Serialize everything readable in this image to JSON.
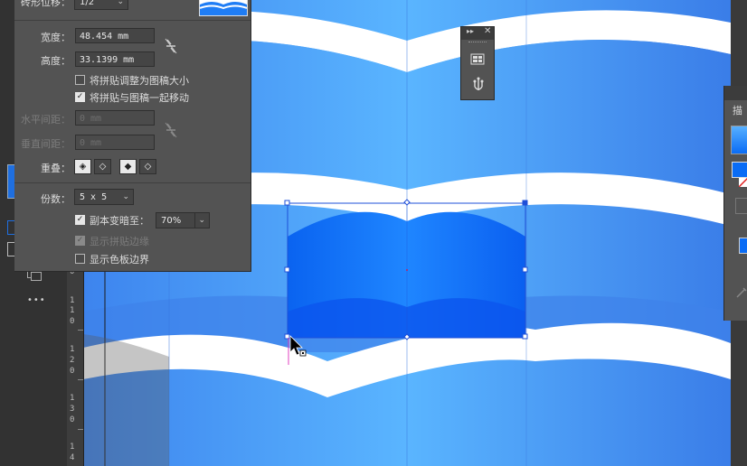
{
  "panel": {
    "tile_offset_label": "砖形位移：",
    "tile_offset_value": "1/2",
    "width_label": "宽度：",
    "width_value": "48.454 mm",
    "height_label": "高度：",
    "height_value": "33.1399 mm",
    "size_tile_to_art": "将拼贴调整为图稿大小",
    "move_tile_with_art": "将拼贴与图稿一起移动",
    "h_spacing_label": "水平间距：",
    "h_spacing_value": "0 mm",
    "v_spacing_label": "垂直间距：",
    "v_spacing_value": "0 mm",
    "overlap_label": "重叠：",
    "copies_label": "份数：",
    "copies_value": "5 x 5",
    "dim_copies_label": "副本变暗至：",
    "dim_copies_value": "70%",
    "show_tile_edge": "显示拼贴边缘",
    "show_swatch_bounds": "显示色板边界"
  },
  "ruler": {
    "marks": [
      {
        "digits": [
          "0"
        ]
      },
      {
        "digits": [
          "1",
          "1",
          "0"
        ]
      },
      {
        "digits": [
          "1",
          "2",
          "0"
        ]
      },
      {
        "digits": [
          "1",
          "3",
          "0"
        ]
      },
      {
        "digits": [
          "1",
          "4"
        ]
      }
    ]
  },
  "right_panel": {
    "tab_label": "描"
  },
  "toolbar": {
    "more_tools": "•••"
  },
  "colors": {
    "canvas_blue": "#4f8af5",
    "wave_light": "#57b3ff",
    "wave_dark": "#3a7de8",
    "tile_fill": "#0a6cf5",
    "panel_bg": "#535353",
    "selection": "#1e4fd8"
  }
}
